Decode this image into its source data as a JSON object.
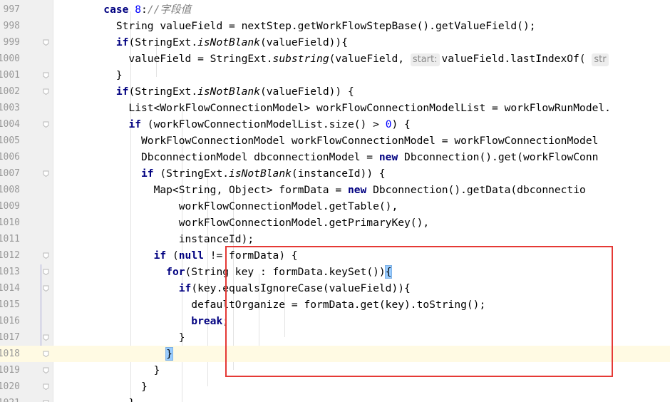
{
  "editor": {
    "lines": [
      {
        "num": "997",
        "segs": [
          {
            "t": "        ",
            "c": ""
          },
          {
            "t": "case",
            "c": "kw"
          },
          {
            "t": " ",
            "c": ""
          },
          {
            "t": "8",
            "c": "num"
          },
          {
            "t": ":",
            "c": ""
          },
          {
            "t": "//字段值",
            "c": "cmt"
          }
        ]
      },
      {
        "num": "998",
        "segs": [
          {
            "t": "          String valueField = nextStep.getWorkFlowStepBase().getValueField();",
            "c": ""
          }
        ]
      },
      {
        "num": "999",
        "segs": [
          {
            "t": "          ",
            "c": ""
          },
          {
            "t": "if",
            "c": "kw"
          },
          {
            "t": "(StringExt.",
            "c": ""
          },
          {
            "t": "isNotBlank",
            "c": "it"
          },
          {
            "t": "(valueField)){",
            "c": ""
          }
        ]
      },
      {
        "num": "1000",
        "segs": [
          {
            "t": "            valueField = StringExt.",
            "c": ""
          },
          {
            "t": "substring",
            "c": "it"
          },
          {
            "t": "(valueField, ",
            "c": ""
          },
          {
            "t": "start:",
            "c": "hint"
          },
          {
            "t": "valueField.lastIndexOf( ",
            "c": ""
          },
          {
            "t": "str",
            "c": "hint"
          }
        ]
      },
      {
        "num": "1001",
        "segs": [
          {
            "t": "          }",
            "c": ""
          }
        ]
      },
      {
        "num": "1002",
        "segs": [
          {
            "t": "          ",
            "c": ""
          },
          {
            "t": "if",
            "c": "kw"
          },
          {
            "t": "(StringExt.",
            "c": ""
          },
          {
            "t": "isNotBlank",
            "c": "it"
          },
          {
            "t": "(valueField)) {",
            "c": ""
          }
        ]
      },
      {
        "num": "1003",
        "segs": [
          {
            "t": "            List<WorkFlowConnectionModel> workFlowConnectionModelList = workFlowRunModel.",
            "c": ""
          }
        ]
      },
      {
        "num": "1004",
        "segs": [
          {
            "t": "            ",
            "c": ""
          },
          {
            "t": "if",
            "c": "kw"
          },
          {
            "t": " (workFlowConnectionModelList.size() > ",
            "c": ""
          },
          {
            "t": "0",
            "c": "num"
          },
          {
            "t": ") {",
            "c": ""
          }
        ]
      },
      {
        "num": "1005",
        "segs": [
          {
            "t": "              WorkFlowConnectionModel workFlowConnectionModel = workFlowConnectionModel",
            "c": ""
          }
        ]
      },
      {
        "num": "1006",
        "segs": [
          {
            "t": "              DbconnectionModel dbconnectionModel = ",
            "c": ""
          },
          {
            "t": "new",
            "c": "kw"
          },
          {
            "t": " Dbconnection().get(workFlowConn",
            "c": ""
          }
        ]
      },
      {
        "num": "1007",
        "segs": [
          {
            "t": "              ",
            "c": ""
          },
          {
            "t": "if",
            "c": "kw"
          },
          {
            "t": " (StringExt.",
            "c": ""
          },
          {
            "t": "isNotBlank",
            "c": "it"
          },
          {
            "t": "(instanceId)) {",
            "c": ""
          }
        ]
      },
      {
        "num": "1008",
        "segs": [
          {
            "t": "                Map<String, Object> formData = ",
            "c": ""
          },
          {
            "t": "new",
            "c": "kw"
          },
          {
            "t": " Dbconnection().getData(dbconnectio",
            "c": ""
          }
        ]
      },
      {
        "num": "1009",
        "segs": [
          {
            "t": "                    workFlowConnectionModel.getTable(),",
            "c": ""
          }
        ]
      },
      {
        "num": "1010",
        "segs": [
          {
            "t": "                    workFlowConnectionModel.getPrimaryKey(),",
            "c": ""
          }
        ]
      },
      {
        "num": "1011",
        "segs": [
          {
            "t": "                    instanceId);",
            "c": ""
          }
        ]
      },
      {
        "num": "1012",
        "segs": [
          {
            "t": "                ",
            "c": ""
          },
          {
            "t": "if",
            "c": "kw"
          },
          {
            "t": " (",
            "c": ""
          },
          {
            "t": "null",
            "c": "kw"
          },
          {
            "t": " != formData) {",
            "c": ""
          }
        ]
      },
      {
        "num": "1013",
        "segs": [
          {
            "t": "                  ",
            "c": ""
          },
          {
            "t": "for",
            "c": "kw"
          },
          {
            "t": "(String key : formData.keySet())",
            "c": ""
          },
          {
            "t": "{",
            "c": "bracematch"
          }
        ]
      },
      {
        "num": "1014",
        "segs": [
          {
            "t": "                    ",
            "c": ""
          },
          {
            "t": "if",
            "c": "kw"
          },
          {
            "t": "(key.equalsIgnoreCase(valueField)){",
            "c": ""
          }
        ]
      },
      {
        "num": "1015",
        "segs": [
          {
            "t": "                      defaultOrganize = formData.get(key).toString();",
            "c": ""
          }
        ]
      },
      {
        "num": "1016",
        "segs": [
          {
            "t": "                      ",
            "c": ""
          },
          {
            "t": "break",
            "c": "kw"
          },
          {
            "t": ";",
            "c": ""
          }
        ]
      },
      {
        "num": "1017",
        "segs": [
          {
            "t": "                    }",
            "c": ""
          }
        ]
      },
      {
        "num": "1018",
        "segs": [
          {
            "t": "                  ",
            "c": ""
          },
          {
            "t": "}",
            "c": "bracematch"
          }
        ]
      },
      {
        "num": "1019",
        "segs": [
          {
            "t": "                }",
            "c": ""
          }
        ]
      },
      {
        "num": "1020",
        "segs": [
          {
            "t": "              }",
            "c": ""
          }
        ]
      },
      {
        "num": "1021",
        "segs": [
          {
            "t": "            }",
            "c": ""
          }
        ]
      }
    ],
    "current_line": "1018",
    "fold_lines": [
      "999",
      "1001",
      "1002",
      "1004",
      "1007",
      "1012",
      "1013",
      "1014",
      "1017",
      "1018",
      "1019",
      "1020",
      "1021"
    ],
    "colors": {
      "keyword": "#000080",
      "number": "#0000ff",
      "comment": "#808080",
      "current_line": "#fffae3",
      "brace_match": "#99ccff",
      "annotation_box": "#e53935"
    }
  }
}
